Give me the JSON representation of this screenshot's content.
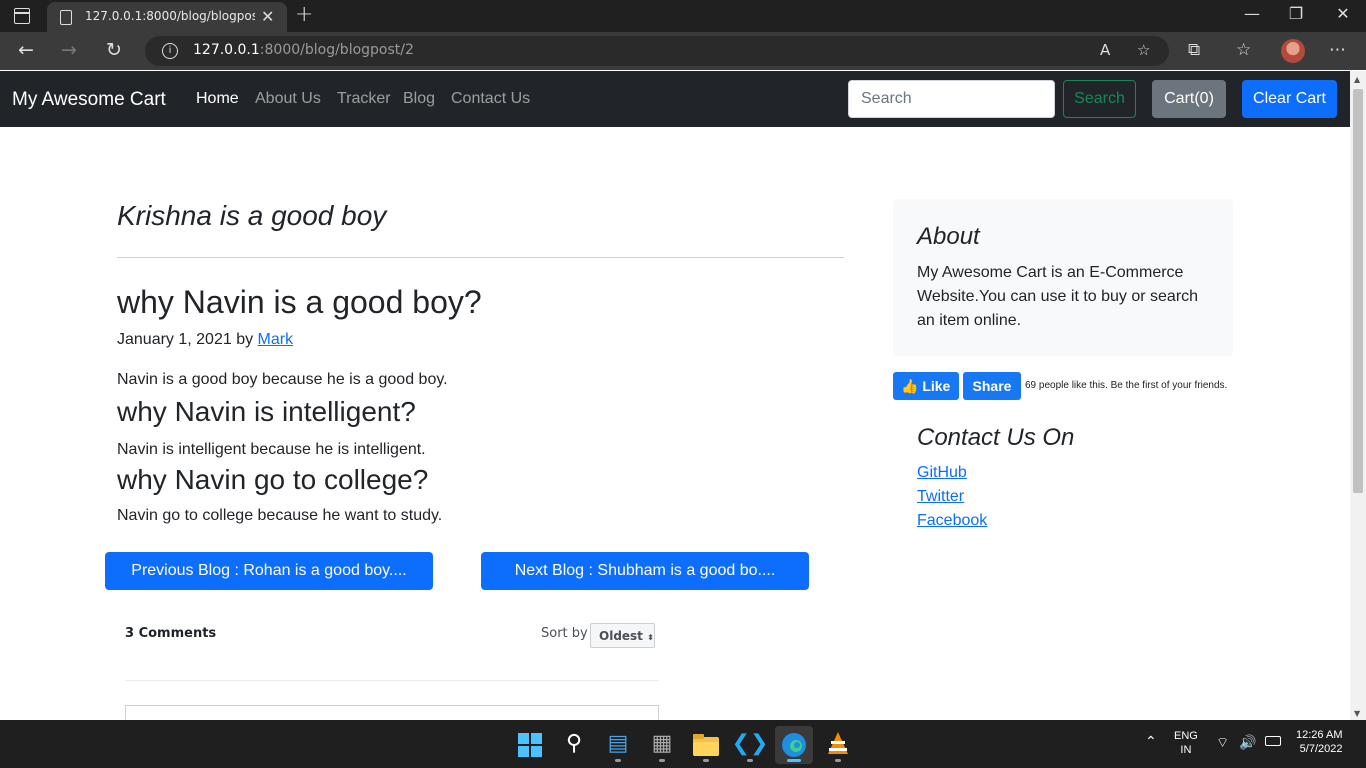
{
  "browser": {
    "tab_title": "127.0.0.1:8000/blog/blogpost/2",
    "url_host": "127.0.0.1",
    "url_rest": ":8000/blog/blogpost/2"
  },
  "navbar": {
    "brand": "My Awesome Cart",
    "links": [
      "Home",
      "About Us",
      "Tracker",
      "Blog",
      "Contact Us"
    ],
    "search_placeholder": "Search",
    "search_button": "Search",
    "cart_button": "Cart(0)",
    "clear_cart_button": "Clear Cart"
  },
  "main": {
    "page_heading": "Krishna is a good boy",
    "post_title": "why Navin is a good boy?",
    "post_date": "January 1, 2021 by ",
    "post_author": "Mark",
    "content": [
      {
        "type": "p",
        "text": "Navin is a good boy because he is a good boy."
      },
      {
        "type": "h",
        "text": "why Navin is intelligent?"
      },
      {
        "type": "p",
        "text": "Navin is intelligent because he is intelligent."
      },
      {
        "type": "h",
        "text": "why Navin go to college?"
      },
      {
        "type": "p",
        "text": "Navin go to college because he want to study."
      }
    ],
    "prev_button": "Previous Blog : Rohan is a good boy....",
    "next_button": "Next Blog : Shubham is a good bo...."
  },
  "comments": {
    "count": "3 Comments",
    "sort_label": "Sort by",
    "sort_value": "Oldest"
  },
  "sidebar": {
    "about_title": "About",
    "about_text": "My Awesome Cart is an E-Commerce Website.You can use it to buy or search an item online.",
    "fb_like": "Like",
    "fb_share": "Share",
    "fb_text": "69 people like this. Be the first of your friends.",
    "contact_title": "Contact Us On",
    "contact_links": [
      "GitHub",
      "Twitter",
      "Facebook"
    ]
  },
  "taskbar": {
    "lang_top": "ENG",
    "lang_bottom": "IN",
    "time": "12:26 AM",
    "date": "5/7/2022"
  }
}
